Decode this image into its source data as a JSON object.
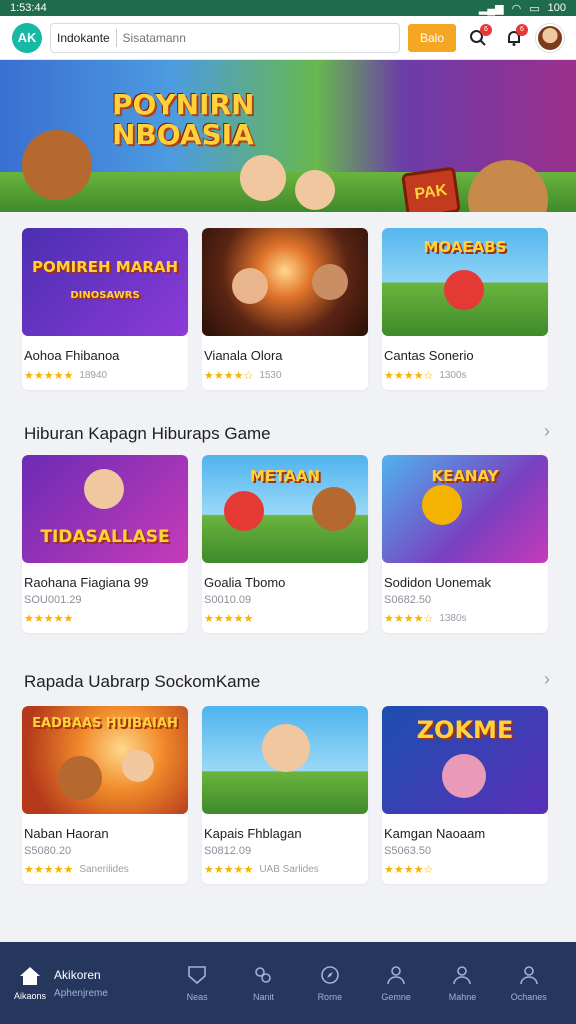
{
  "status": {
    "time": "1:53:44",
    "battery": "100"
  },
  "topbar": {
    "logo_text": "AK",
    "search_context": "Indokante",
    "search_placeholder": "Sisatamann",
    "search_button": "Balo",
    "notif_badge_1": "6",
    "notif_badge_2": "6"
  },
  "hero": {
    "title_line1": "POYNIRN",
    "title_line2": "NBOASIA",
    "sign_text": "PAK"
  },
  "featured": [
    {
      "name": "Aohoa Fhibanoa",
      "rating_count": "18940",
      "stars": "★★★★★",
      "thumb_title": "POMIREH MARAH",
      "thumb_sub": "DINOSAWRS"
    },
    {
      "name": "Vianala Olora",
      "rating_count": "1530",
      "stars": "★★★★☆",
      "thumb_title": "",
      "thumb_sub": ""
    },
    {
      "name": "Cantas Sonerio",
      "rating_count": "1300s",
      "stars": "★★★★☆",
      "thumb_title": "MOAEABS",
      "thumb_sub": ""
    }
  ],
  "section1": {
    "title": "Hiburan Kapagn Hiburaps Game",
    "items": [
      {
        "name": "Raohana Fiagiana 99",
        "price": "SOU001.29",
        "stars": "★★★★★",
        "rating_count": "",
        "thumb_title": "TIDASALLASE"
      },
      {
        "name": "Goalia Tbomo",
        "price": "S0010.09",
        "stars": "★★★★★",
        "rating_count": "",
        "thumb_title": "METAAN"
      },
      {
        "name": "Sodidon Uonemak",
        "price": "S0682.50",
        "stars": "★★★★☆",
        "rating_count": "1380s",
        "thumb_title": "KEANAY"
      }
    ]
  },
  "section2": {
    "title": "Rapada Uabrarp SockomKame",
    "items": [
      {
        "name": "Naban Haoran",
        "price": "S5080.20",
        "stars": "★★★★★",
        "rating_count": "Sanerilides",
        "thumb_title": "EADBAAS HUIBAIAH"
      },
      {
        "name": "Kapais Fhblagan",
        "price": "S0812.09",
        "stars": "★★★★★",
        "rating_count": "UAB Sarlides",
        "thumb_title": ""
      },
      {
        "name": "Kamgan Naoaam",
        "price": "S5063.50",
        "stars": "★★★★☆",
        "rating_count": "",
        "thumb_title": "ZOKME"
      }
    ]
  },
  "nav": {
    "active_label": "Akikoren",
    "active_sub": "Aphenjreme",
    "home_label": "Aikaons",
    "items": [
      "Neas",
      "Nanit",
      "Rorne",
      "Gemne",
      "Mahne",
      "Ochanes"
    ]
  },
  "colors": {
    "accent": "#f5a623",
    "nav_bg": "#26375e",
    "star": "#f5b301",
    "status_bar": "#1f6b4e"
  }
}
